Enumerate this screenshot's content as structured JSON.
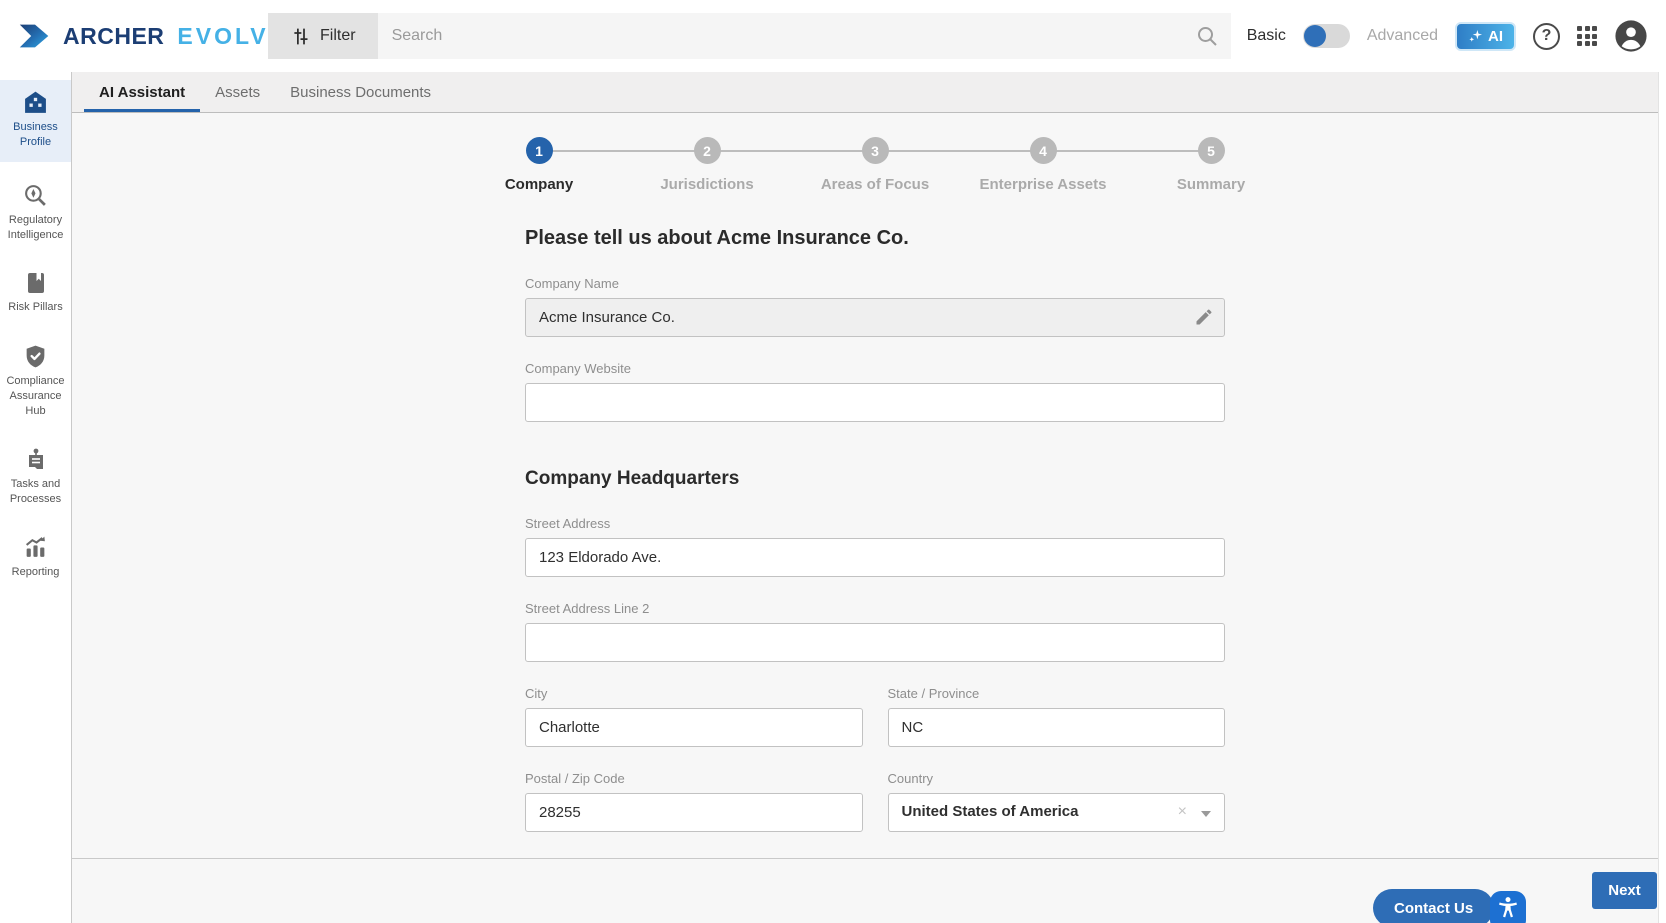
{
  "header": {
    "brand": {
      "primary": "ARCHER",
      "secondary": "EVOLV"
    },
    "filter_label": "Filter",
    "search_placeholder": "Search",
    "toggle": {
      "left_label": "Basic",
      "right_label": "Advanced",
      "state": "basic"
    },
    "ai_label": "AI",
    "icons": [
      "sliders-filter-icon",
      "search-icon",
      "ai-sparkle-icon",
      "help-icon",
      "app-grid-icon",
      "user-avatar-icon"
    ]
  },
  "sidebar": {
    "items": [
      {
        "label": "Business Profile",
        "icon": "building-org-icon",
        "active": true
      },
      {
        "label": "Regulatory Intelligence",
        "icon": "regulatory-search-icon",
        "active": false
      },
      {
        "label": "Risk Pillars",
        "icon": "book-bookmark-icon",
        "active": false
      },
      {
        "label": "Compliance Assurance Hub",
        "icon": "shield-check-icon",
        "active": false
      },
      {
        "label": "Tasks and Processes",
        "icon": "clipboard-tasks-icon",
        "active": false
      },
      {
        "label": "Reporting",
        "icon": "chart-report-icon",
        "active": false
      }
    ]
  },
  "tabs": [
    {
      "label": "AI Assistant",
      "active": true
    },
    {
      "label": "Assets",
      "active": false
    },
    {
      "label": "Business Documents",
      "active": false
    }
  ],
  "stepper": {
    "steps": [
      {
        "number": "1",
        "label": "Company",
        "active": true
      },
      {
        "number": "2",
        "label": "Jurisdictions",
        "active": false
      },
      {
        "number": "3",
        "label": "Areas of Focus",
        "active": false
      },
      {
        "number": "4",
        "label": "Enterprise Assets",
        "active": false
      },
      {
        "number": "5",
        "label": "Summary",
        "active": false
      }
    ]
  },
  "form": {
    "title": "Please tell us about Acme Insurance Co.",
    "section_title": "Company Headquarters",
    "fields": {
      "company_name": {
        "label": "Company Name",
        "value": "Acme Insurance Co.",
        "readonly": true
      },
      "company_website": {
        "label": "Company Website",
        "value": ""
      },
      "street_address": {
        "label": "Street Address",
        "value": "123 Eldorado Ave."
      },
      "street_address_2": {
        "label": "Street Address Line 2",
        "value": ""
      },
      "city": {
        "label": "City",
        "value": "Charlotte"
      },
      "state": {
        "label": "State / Province",
        "value": "NC"
      },
      "postal": {
        "label": "Postal / Zip Code",
        "value": "28255"
      },
      "country": {
        "label": "Country",
        "value": "United States of America",
        "clear_glyph": "×"
      }
    }
  },
  "footer": {
    "contact_label": "Contact Us",
    "next_label": "Next"
  },
  "colors": {
    "accent_blue": "#2e6db6",
    "active_step_blue": "#2563ab",
    "sidebar_active_bg": "#e7eef8",
    "sidebar_active_text": "#1d4e89",
    "brand_navy": "#1c3e74",
    "brand_light_blue": "#45b1e6",
    "ai_gradient_start": "#2f7ec6",
    "ai_gradient_end": "#4db3e8",
    "a11y_blue": "#1d70d2",
    "content_bg": "#f7f7f7",
    "tabbar_bg": "#f0efef"
  }
}
